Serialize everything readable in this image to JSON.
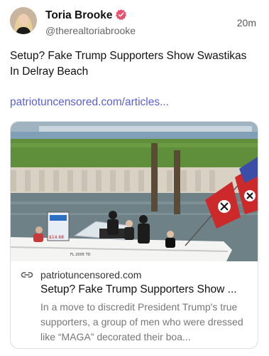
{
  "author": {
    "name": "Toria Brooke",
    "handle": "@therealtoriabrooke",
    "verified_color": "#e8506e"
  },
  "post": {
    "time": "20m",
    "text": "Setup? Fake Trump Supporters Show Swastikas In Delray Beach",
    "link_text": "patriotuncensored.com/articles...",
    "link_color": "#5b5fd6"
  },
  "card": {
    "domain": "patriotuncensored.com",
    "title": "Setup? Fake Trump Supporters Show ...",
    "description": "In a move to discredit President Trump's true supporters, a group of men who were dressed like “MAGA” decorated their boa...",
    "image_sign_number": "$14.68",
    "image_boat_reg": "FL 2005 TD"
  },
  "icons": {
    "verified": "verified-badge-icon",
    "link": "link-chain-icon"
  }
}
